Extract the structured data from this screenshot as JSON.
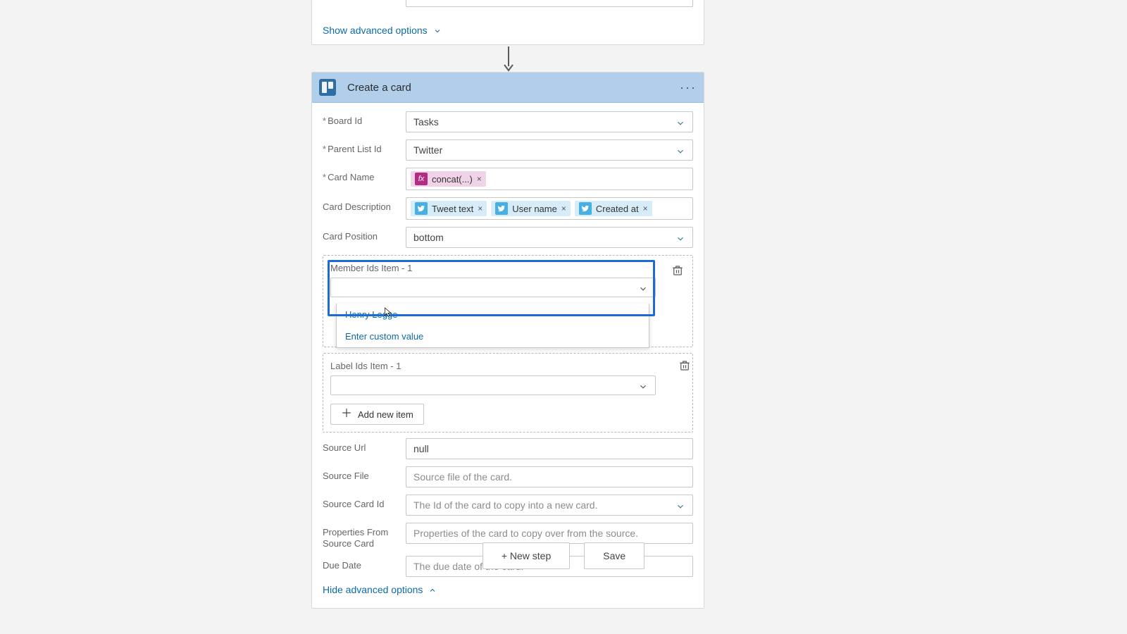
{
  "prev": {
    "adv_toggle": "Show advanced options"
  },
  "main": {
    "title": "Create a card",
    "labels": {
      "board": "Board Id",
      "parent": "Parent List Id",
      "name": "Card Name",
      "desc": "Card Description",
      "pos": "Card Position",
      "member_item": "Member Ids Item - 1",
      "label_item": "Label Ids Item - 1",
      "add_item": "Add new item",
      "src_url": "Source Url",
      "src_file": "Source File",
      "src_card": "Source Card Id",
      "props": "Properties From Source Card",
      "due": "Due Date",
      "hide_adv": "Hide advanced options"
    },
    "values": {
      "board": "Tasks",
      "parent": "Twitter",
      "pos": "bottom",
      "src_url": "null"
    },
    "placeholders": {
      "src_file": "Source file of the card.",
      "src_card": "The Id of the card to copy into a new card.",
      "props": "Properties of the card to copy over from the source.",
      "due": "The due date of the card."
    },
    "tokens": {
      "name_fx": "concat(...)",
      "desc_tweet": "Tweet text",
      "desc_user": "User name",
      "desc_created": "Created at"
    },
    "dropdown": {
      "opt1": "Henry Legge",
      "opt2": "Enter custom value"
    }
  },
  "footer": {
    "new_step": "+  New step",
    "save": "Save"
  }
}
